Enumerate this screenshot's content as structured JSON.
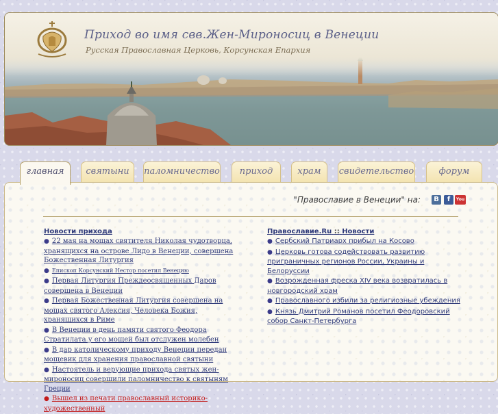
{
  "header": {
    "title": "Приход во имя свв.Жен-Мироносиц в Венеции",
    "subtitle": "Русская Православная Церковь, Корсунская Епархия"
  },
  "nav": {
    "tabs": [
      {
        "label": "главная",
        "active": true
      },
      {
        "label": "святыни",
        "active": false
      },
      {
        "label": "паломничество",
        "active": false
      },
      {
        "label": "приход",
        "active": false
      },
      {
        "label": "храм",
        "active": false
      },
      {
        "label": "свидетельство",
        "active": false
      },
      {
        "label": "форум",
        "active": false
      }
    ]
  },
  "social": {
    "caption": "\"Православие в Венеции\" на:",
    "vk": "В",
    "fb": "f",
    "yt": "You"
  },
  "parish_news": {
    "heading": "Новости прихода",
    "items": [
      "22 мая на мощах святителя Николая чудотворца, хранящихся на острове Лидо в Венеции, совершена Божественная Литургия",
      "Епископ Корсунский Нестор посетил Венецию",
      "Первая Литургия Преждеосвященных Даров совершена в Венеции",
      "Первая Божественная Литургия совершена на мощах святого Алексия, Человека Божия, хранящихся в Риме",
      "В Венеции в день памяти святого Феодора Стратилата у его мощей был отслужен молебен",
      "В дар католическому приходу Венеции передан мощевик для хранения православной святыни",
      "Настоятель и верующие прихода святых жен-мироносиц совершили паломничество к святыням Греции",
      "Вышел из печати православный историко-художественный"
    ]
  },
  "pravoslavie_news": {
    "source": "Православие.Ru",
    "separator": "::",
    "heading": "Новости",
    "items": [
      "Сербский Патриарх прибыл на Косово",
      "Церковь готова содействовать развитию приграничных регионов России, Украины и Белоруссии",
      "Возрожденная фреска XIV века возвратилась в новгородский храм",
      "Православного избили за религиозные убеждения",
      "Князь Дмитрий Романов посетил Феодоровский собор Санкт-Петербурга"
    ]
  },
  "colors": {
    "link": "#2f3a7a",
    "highlight": "#c21a1a",
    "tab_bg": "#f3e3b0",
    "title": "#5b5f88"
  }
}
